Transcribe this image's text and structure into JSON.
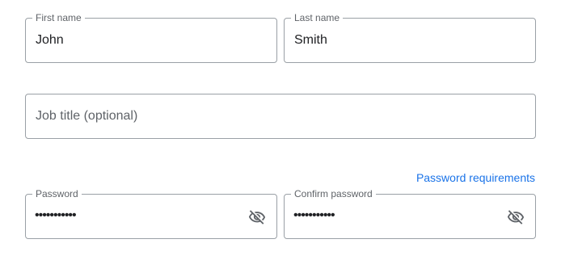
{
  "first_name": {
    "label": "First name",
    "value": "John"
  },
  "last_name": {
    "label": "Last name",
    "value": "Smith"
  },
  "job_title": {
    "placeholder": "Job title (optional)"
  },
  "password_requirements_link": "Password requirements",
  "password": {
    "label": "Password",
    "value": "•••••••••••",
    "toggle_icon": "eye-off-icon"
  },
  "confirm_password": {
    "label": "Confirm password",
    "value": "•••••••••••",
    "toggle_icon": "eye-off-icon"
  },
  "colors": {
    "border": "#9aa0a6",
    "label": "#5f6368",
    "text": "#202124",
    "link": "#1a73e8"
  }
}
